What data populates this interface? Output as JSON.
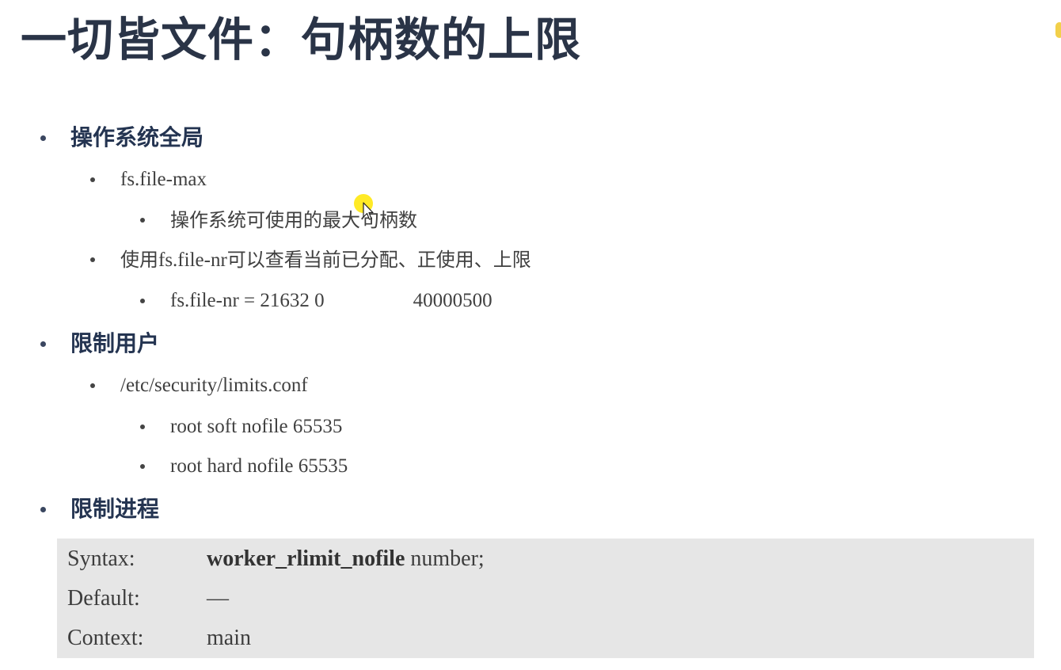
{
  "title": "一切皆文件：句柄数的上限",
  "sections": [
    {
      "heading": "操作系统全局",
      "items": [
        {
          "text": "fs.file-max",
          "sub": [
            "操作系统可使用的最大句柄数"
          ]
        },
        {
          "text_cjk_1": "使用",
          "text_code": "fs.file-nr",
          "text_cjk_2": "可以查看当前已分配、正使用、上限",
          "sub_nr": {
            "prefix": "fs.file-nr = 21632  0",
            "limit": "40000500"
          }
        }
      ]
    },
    {
      "heading": "限制用户",
      "items": [
        {
          "text": "/etc/security/limits.conf",
          "sub": [
            "root soft nofile 65535",
            "root hard nofile 65535"
          ]
        }
      ]
    },
    {
      "heading": "限制进程",
      "syntax": {
        "rows": [
          {
            "label": "Syntax:",
            "directive": "worker_rlimit_nofile",
            "rest": " number;"
          },
          {
            "label": "Default:",
            "value": "—"
          },
          {
            "label": "Context:",
            "value": "main"
          }
        ]
      }
    }
  ],
  "colors": {
    "title": "#2a3447",
    "heading": "#243451",
    "body_text": "#404040",
    "syntax_bg": "#e6e6e6",
    "cursor_highlight": "#ffe600"
  },
  "icons": {
    "cursor": "mouse-pointer-icon"
  }
}
